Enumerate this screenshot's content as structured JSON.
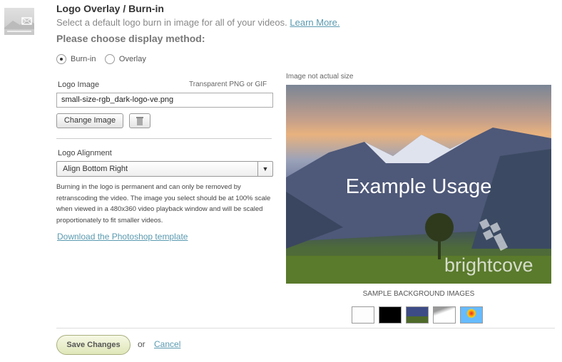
{
  "header": {
    "title": "Logo Overlay / Burn-in",
    "subtitle": "Select a default logo burn in image for all of your videos.",
    "learn_more": "Learn More.",
    "method_prompt": "Please choose display method:"
  },
  "method": {
    "options": [
      {
        "label": "Burn-in",
        "selected": true
      },
      {
        "label": "Overlay",
        "selected": false
      }
    ]
  },
  "logo_image": {
    "label": "Logo Image",
    "hint": "Transparent PNG or GIF",
    "value": "small-size-rgb_dark-logo-ve.png",
    "change_button": "Change Image",
    "delete_icon": "trash-icon"
  },
  "alignment": {
    "label": "Logo Alignment",
    "selected": "Align Bottom Right"
  },
  "note": "Burning in the logo is permanent and can only be removed by retranscoding the video. The image you select should be at 100% scale when viewed in a 480x360 video playback window and will be scaled proportionately to fit smaller videos.",
  "download_link": "Download the Photoshop template",
  "preview": {
    "caption": "Image not actual size",
    "overlay_text": "Example Usage",
    "logo_text": "brightcove"
  },
  "samples": {
    "title": "SAMPLE BACKGROUND IMAGES",
    "items": [
      "white",
      "black",
      "landscape",
      "snow",
      "balloon"
    ]
  },
  "footer": {
    "save": "Save Changes",
    "or": "or",
    "cancel": "Cancel"
  }
}
